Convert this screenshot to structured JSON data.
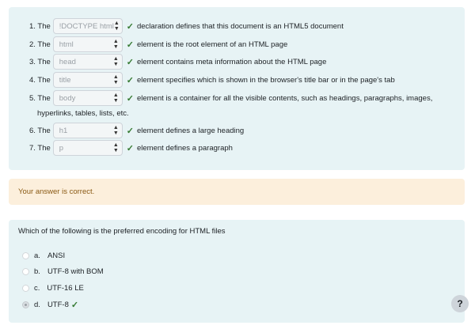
{
  "q1": {
    "rows": [
      {
        "num": "1. The",
        "select": "!DOCTYPE html",
        "rest": "declaration defines that this document is an HTML5 document"
      },
      {
        "num": "2. The",
        "select": "html",
        "rest": "element is the root element of an HTML page"
      },
      {
        "num": "3. The",
        "select": "head",
        "rest": "element contains meta information about the HTML page"
      },
      {
        "num": "4. The",
        "select": "title",
        "rest": "element specifies which is shown in the browser's title bar or in the page's tab"
      },
      {
        "num": "5. The",
        "select": "body",
        "rest": "element  is a container for all the visible contents, such as headings, paragraphs, images,"
      },
      {
        "num": "6. The",
        "select": "h1",
        "rest": "element defines a large heading"
      },
      {
        "num": "7. The",
        "select": "p",
        "rest": "element defines a paragraph"
      }
    ],
    "wrap_line": "hyperlinks, tables, lists, etc."
  },
  "feedback": "Your answer is correct.",
  "q2": {
    "question": "Which of the following is the preferred encoding for HTML files",
    "options": [
      {
        "label": "a.",
        "text": "ANSI"
      },
      {
        "label": "b.",
        "text": "UTF-8 with BOM"
      },
      {
        "label": "c.",
        "text": "UTF-16 LE"
      },
      {
        "label": "d.",
        "text": "UTF-8"
      }
    ],
    "selected_option": "d.",
    "help": "?"
  },
  "icons": {
    "correct": "check-icon",
    "select_arrows": "updown-arrows-icon"
  },
  "colors": {
    "correct": "#357a32",
    "feedback_bg": "#fcefdc",
    "panel_bg": "#e7f3f5"
  }
}
